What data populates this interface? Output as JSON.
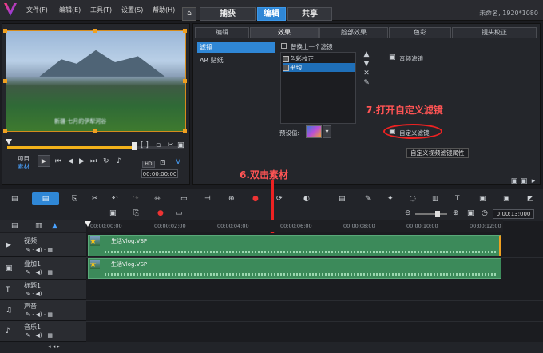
{
  "menubar": {
    "items": [
      "文件(F)",
      "编辑(E)",
      "工具(T)",
      "设置(S)",
      "帮助(H)"
    ],
    "home_icon": "home-icon",
    "tabs": [
      "捕获",
      "编辑",
      "共享"
    ],
    "active_tab": "编辑",
    "project_info": "未命名, 1920*1080"
  },
  "preview": {
    "caption": "新疆·七月的伊犁河谷",
    "timecode": "00:00:00:00",
    "mode_labels": [
      "项目",
      "素材"
    ],
    "controls": [
      "play",
      "start",
      "prev-frame",
      "next-frame",
      "end",
      "repeat",
      "volume"
    ],
    "hd_label": "HD",
    "brackets": "[ ]"
  },
  "effects": {
    "subtabs": [
      "编辑",
      "效果",
      "脸部效果",
      "色彩",
      "镜头校正"
    ],
    "active_subtab": "效果",
    "categories": [
      "滤镜",
      "AR 贴纸"
    ],
    "active_category": "滤镜",
    "replace_label": "替换上一个滤镜",
    "filter_items": [
      "色彩校正",
      "平均"
    ],
    "selected_filter": "平均",
    "preset_label": "预设值:",
    "audio_filter_label": "音频滤镜",
    "custom_filter_label": "自定义滤镜",
    "tooltip": "自定义视频滤镜属性"
  },
  "annotations": {
    "step7": "7.打开自定义滤镜",
    "step6": "6.双击素材"
  },
  "timeline": {
    "ruler": [
      "00:00:00:00",
      "00:00:02:00",
      "00:00:04:00",
      "00:00:06:00",
      "00:00:08:00",
      "00:00:10:00",
      "00:00:12:00"
    ],
    "zoom_time": "0:00:13:000",
    "tracks": [
      {
        "name": "视频",
        "icon": "video-track-icon"
      },
      {
        "name": "叠加1",
        "icon": "overlay-track-icon"
      },
      {
        "name": "标题1",
        "icon": "title-track-icon"
      },
      {
        "name": "声音",
        "icon": "voice-track-icon"
      },
      {
        "name": "音乐1",
        "icon": "music-track-icon"
      }
    ],
    "clips": [
      {
        "label": "生活Vlog.VSP"
      },
      {
        "label": "生活Vlog.VSP"
      }
    ]
  },
  "colors": {
    "accent": "#2f87d6",
    "annotation": "#ff5454",
    "clip": "#3c8a5a",
    "playhead": "#f3b21b"
  }
}
